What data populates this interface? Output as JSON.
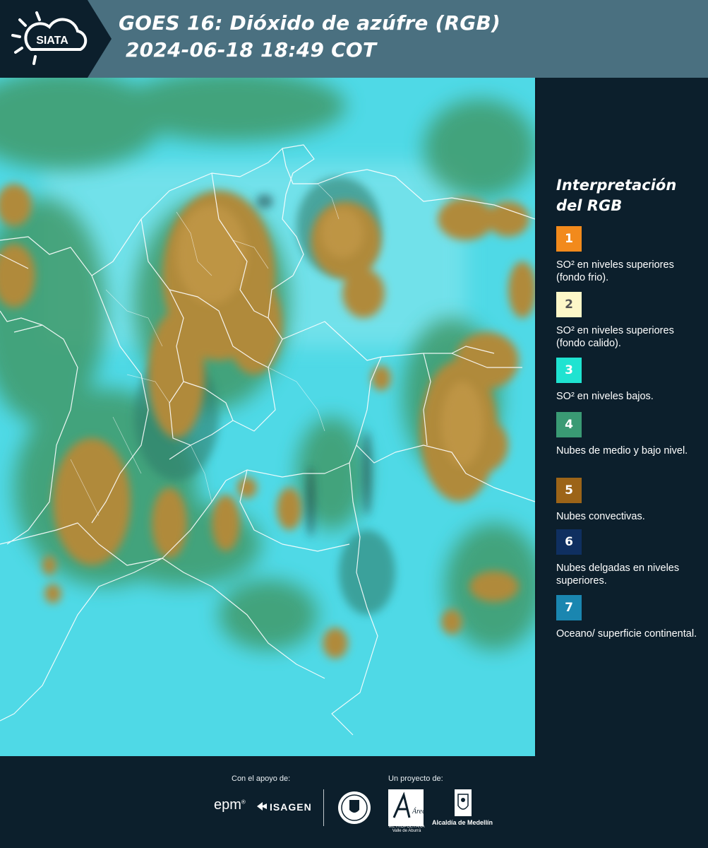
{
  "header": {
    "logo_text": "SIATA",
    "title_line1": "GOES 16: Dióxido de azúfre (RGB)",
    "title_line2": " 2024-06-18 18:49 COT"
  },
  "map": {
    "background_color": "#4fd9e6",
    "cloud_color": "#b08a3a",
    "low_cloud_color": "#3f9a6a",
    "border_color": "#ffffff"
  },
  "legend": {
    "title_line1": "Interpretación",
    "title_line2": "del RGB",
    "items": [
      {
        "number": "1",
        "color": "#f28a1c",
        "label": "SO² en niveles superiores (fondo frio)."
      },
      {
        "number": "2",
        "color": "#fdf7c8",
        "label": "SO² en niveles superiores (fondo calido)."
      },
      {
        "number": "3",
        "color": "#1fe3d1",
        "label": "SO² en niveles bajos."
      },
      {
        "number": "4",
        "color": "#3a9a74",
        "label": "Nubes de medio y bajo nivel."
      },
      {
        "number": "5",
        "color": "#9c6418",
        "label": "Nubes convectivas."
      },
      {
        "number": "6",
        "color": "#0f2f60",
        "label": "Nubes delgadas en niveles superiores."
      },
      {
        "number": "7",
        "color": "#1a86b0",
        "label": "Oceano/ superficie continental."
      }
    ]
  },
  "footer": {
    "support_label": "Con el apoyo de:",
    "project_label": "Un proyecto de:",
    "epm_logo": "epm",
    "isagen_logo": "ISAGEN",
    "area_logo": "Área",
    "area_caption_line1": "METROPOLITANA",
    "area_caption_line2": "Valle de Aburrá",
    "alcaldia_caption": "Alcaldía de Medellín"
  }
}
